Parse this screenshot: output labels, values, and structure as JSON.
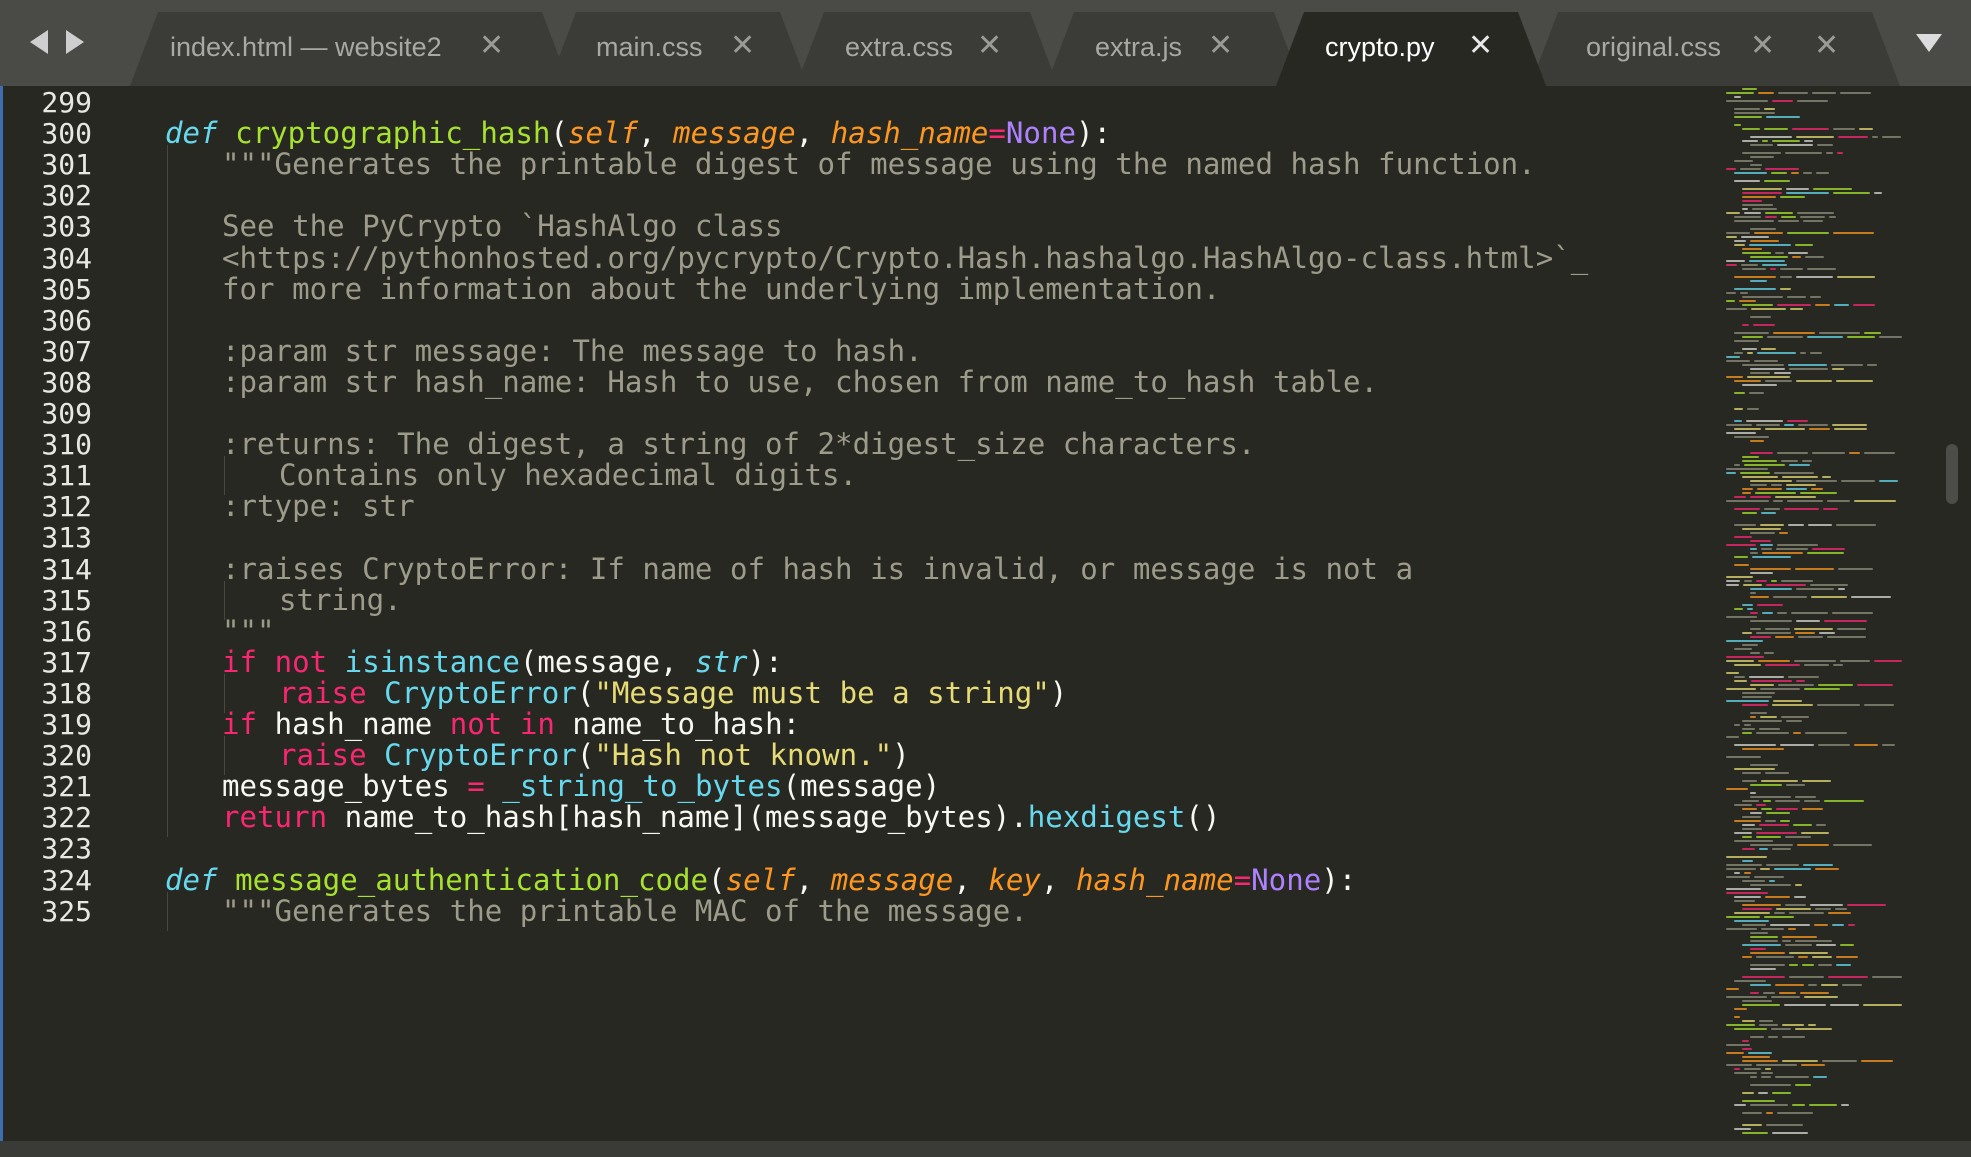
{
  "window": {
    "tabs": [
      {
        "label": "index.html — website2",
        "active": false
      },
      {
        "label": "main.css",
        "active": false
      },
      {
        "label": "extra.css",
        "active": false
      },
      {
        "label": "extra.js",
        "active": false
      },
      {
        "label": "crypto.py",
        "active": true
      },
      {
        "label": "original.css",
        "active": false
      }
    ],
    "close_glyph": "✕"
  },
  "icons": {
    "nav_back": "triangle-left-icon",
    "nav_forward": "triangle-right-icon",
    "tab_close": "close-icon",
    "tab_overflow": "chevron-down-icon"
  },
  "theme": {
    "background": "#272822",
    "tabbar": "#4a4a47",
    "keyword": "#f92672",
    "function": "#a6e22e",
    "parameter": "#fd971f",
    "constant": "#ae81ff",
    "string": "#e6db74",
    "builtin": "#66d9ef",
    "comment": "#9d9b8a"
  },
  "editor": {
    "file": "crypto.py",
    "lines": [
      {
        "num": "299",
        "indent": 0,
        "tokens": []
      },
      {
        "num": "300",
        "indent": 1,
        "tokens": [
          [
            "def",
            "def"
          ],
          [
            "p",
            " "
          ],
          [
            "fn",
            "cryptographic_hash"
          ],
          [
            "p",
            "("
          ],
          [
            "prm",
            "self"
          ],
          [
            "p",
            ", "
          ],
          [
            "prm",
            "message"
          ],
          [
            "p",
            ", "
          ],
          [
            "prm",
            "hash_name"
          ],
          [
            "op",
            "="
          ],
          [
            "cst",
            "None"
          ],
          [
            "p",
            "):"
          ]
        ]
      },
      {
        "num": "301",
        "indent": 2,
        "tokens": [
          [
            "cmt",
            "\"\"\"Generates the printable digest of message using the named hash function."
          ]
        ]
      },
      {
        "num": "302",
        "indent": 2,
        "tokens": []
      },
      {
        "num": "303",
        "indent": 2,
        "tokens": [
          [
            "cmt",
            "See the PyCrypto `HashAlgo class"
          ]
        ]
      },
      {
        "num": "304",
        "indent": 2,
        "tokens": [
          [
            "cmt",
            "<https://pythonhosted.org/pycrypto/Crypto.Hash.hashalgo.HashAlgo-class.html>`_"
          ]
        ]
      },
      {
        "num": "305",
        "indent": 2,
        "tokens": [
          [
            "cmt",
            "for more information about the underlying implementation."
          ]
        ]
      },
      {
        "num": "306",
        "indent": 2,
        "tokens": []
      },
      {
        "num": "307",
        "indent": 2,
        "tokens": [
          [
            "cmt",
            ":param str message: The message to hash."
          ]
        ]
      },
      {
        "num": "308",
        "indent": 2,
        "tokens": [
          [
            "cmt",
            ":param str hash_name: Hash to use, chosen from name_to_hash table."
          ]
        ]
      },
      {
        "num": "309",
        "indent": 2,
        "tokens": []
      },
      {
        "num": "310",
        "indent": 2,
        "tokens": [
          [
            "cmt",
            ":returns: The digest, a string of 2*digest_size characters."
          ]
        ]
      },
      {
        "num": "311",
        "indent": 3,
        "tokens": [
          [
            "cmt",
            "Contains only hexadecimal digits."
          ]
        ]
      },
      {
        "num": "312",
        "indent": 2,
        "tokens": [
          [
            "cmt",
            ":rtype: str"
          ]
        ]
      },
      {
        "num": "313",
        "indent": 2,
        "tokens": []
      },
      {
        "num": "314",
        "indent": 2,
        "tokens": [
          [
            "cmt",
            ":raises CryptoError: If name of hash is invalid, or message is not a"
          ]
        ]
      },
      {
        "num": "315",
        "indent": 3,
        "tokens": [
          [
            "cmt",
            "string."
          ]
        ]
      },
      {
        "num": "316",
        "indent": 2,
        "tokens": [
          [
            "cmt",
            "\"\"\""
          ]
        ]
      },
      {
        "num": "317",
        "indent": 2,
        "tokens": [
          [
            "kw",
            "if"
          ],
          [
            "p",
            " "
          ],
          [
            "kw",
            "not"
          ],
          [
            "p",
            " "
          ],
          [
            "bi",
            "isinstance"
          ],
          [
            "p",
            "(message, "
          ],
          [
            "bii",
            "str"
          ],
          [
            "p",
            "):"
          ]
        ]
      },
      {
        "num": "318",
        "indent": 3,
        "tokens": [
          [
            "kw",
            "raise"
          ],
          [
            "p",
            " "
          ],
          [
            "bi",
            "CryptoError"
          ],
          [
            "p",
            "("
          ],
          [
            "str",
            "\"Message must be a string\""
          ],
          [
            "p",
            ")"
          ]
        ]
      },
      {
        "num": "319",
        "indent": 2,
        "tokens": [
          [
            "kw",
            "if"
          ],
          [
            "p",
            " hash_name "
          ],
          [
            "kw",
            "not"
          ],
          [
            "p",
            " "
          ],
          [
            "kw",
            "in"
          ],
          [
            "p",
            " name_to_hash:"
          ]
        ]
      },
      {
        "num": "320",
        "indent": 3,
        "tokens": [
          [
            "kw",
            "raise"
          ],
          [
            "p",
            " "
          ],
          [
            "bi",
            "CryptoError"
          ],
          [
            "p",
            "("
          ],
          [
            "str",
            "\"Hash not known.\""
          ],
          [
            "p",
            ")"
          ]
        ]
      },
      {
        "num": "321",
        "indent": 2,
        "tokens": [
          [
            "p",
            "message_bytes "
          ],
          [
            "op",
            "="
          ],
          [
            "p",
            " "
          ],
          [
            "bi",
            "_string_to_bytes"
          ],
          [
            "p",
            "(message)"
          ]
        ]
      },
      {
        "num": "322",
        "indent": 2,
        "tokens": [
          [
            "kw",
            "return"
          ],
          [
            "p",
            " name_to_hash[hash_name](message_bytes)."
          ],
          [
            "bi",
            "hexdigest"
          ],
          [
            "p",
            "()"
          ]
        ]
      },
      {
        "num": "323",
        "indent": 1,
        "tokens": []
      },
      {
        "num": "324",
        "indent": 1,
        "tokens": [
          [
            "def",
            "def"
          ],
          [
            "p",
            " "
          ],
          [
            "fn",
            "message_authentication_code"
          ],
          [
            "p",
            "("
          ],
          [
            "prm",
            "self"
          ],
          [
            "p",
            ", "
          ],
          [
            "prm",
            "message"
          ],
          [
            "p",
            ", "
          ],
          [
            "prm",
            "key"
          ],
          [
            "p",
            ", "
          ],
          [
            "prm",
            "hash_name"
          ],
          [
            "op",
            "="
          ],
          [
            "cst",
            "None"
          ],
          [
            "p",
            "):"
          ]
        ]
      },
      {
        "num": "325",
        "indent": 2,
        "tokens": [
          [
            "cmt",
            "\"\"\"Generates the printable MAC of the message."
          ]
        ]
      }
    ]
  }
}
